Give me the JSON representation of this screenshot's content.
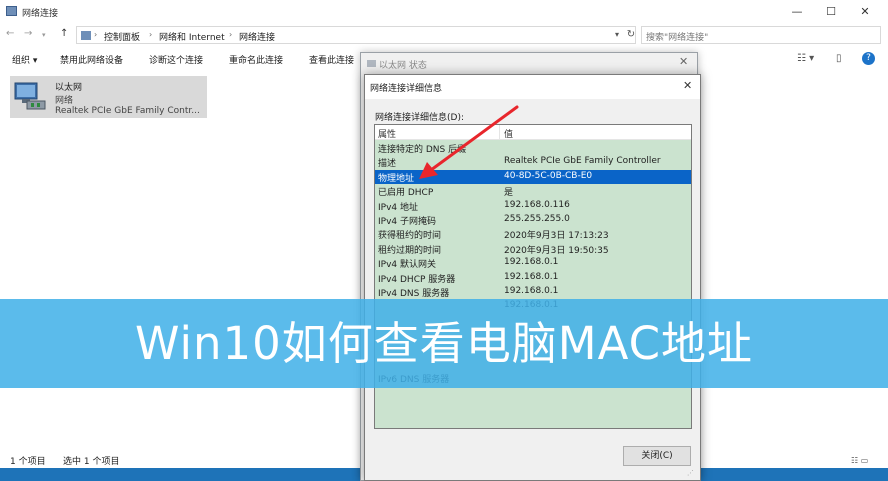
{
  "window": {
    "title": "网络连接",
    "minimize": "—",
    "maximize": "☐",
    "close": "✕"
  },
  "nav": {
    "back": "←",
    "forward": "→",
    "recent": "▾",
    "up": "↑",
    "breadcrumb": [
      "控制面板",
      "网络和 Internet",
      "网络连接"
    ],
    "separator": "›",
    "dropdown": "▾",
    "refresh": "↻",
    "search_placeholder": "搜索\"网络连接\""
  },
  "toolbar": {
    "items": [
      "组织 ▾",
      "禁用此网络设备",
      "诊断这个连接",
      "重命名此连接",
      "查看此连接"
    ],
    "view_icon": "☷ ▾",
    "pane_icon": "▯",
    "help": "?"
  },
  "adapter": {
    "name": "以太网",
    "network": "网络",
    "device": "Realtek PCIe GbE Family Contr..."
  },
  "statusbar": {
    "count": "1 个项目",
    "selected": "选中 1 个项目",
    "view_icons": "☷ ▭"
  },
  "status_dialog": {
    "title": "以太网 状态",
    "close": "✕"
  },
  "detail_dialog": {
    "title": "网络连接详细信息",
    "close": "✕",
    "label": "网络连接详细信息(D):",
    "columns": {
      "property": "属性",
      "value": "值"
    },
    "rows": [
      {
        "property": "连接特定的 DNS 后缀",
        "value": ""
      },
      {
        "property": "描述",
        "value": "Realtek PCIe GbE Family Controller"
      },
      {
        "property": "物理地址",
        "value": "40-8D-5C-0B-CB-E0",
        "selected": true
      },
      {
        "property": "已启用 DHCP",
        "value": "是"
      },
      {
        "property": "IPv4 地址",
        "value": "192.168.0.116"
      },
      {
        "property": "IPv4 子网掩码",
        "value": "255.255.255.0"
      },
      {
        "property": "获得租约的时间",
        "value": "2020年9月3日 17:13:23"
      },
      {
        "property": "租约过期的时间",
        "value": "2020年9月3日 19:50:35"
      },
      {
        "property": "IPv4 默认网关",
        "value": "192.168.0.1"
      },
      {
        "property": "IPv4 DHCP 服务器",
        "value": "192.168.0.1"
      },
      {
        "property": "IPv4 DNS 服务器",
        "value": "192.168.0.1"
      },
      {
        "property": "",
        "value": "192.168.0.1"
      }
    ],
    "partial_row": {
      "property": "IPv6 DNS 服务器",
      "value": ""
    },
    "close_button": "关闭(C)"
  },
  "banner": {
    "text": "Win10如何查看电脑MAC地址"
  },
  "colors": {
    "list_bg": "#cbe3cf",
    "selection": "#0a64c8",
    "banner": "#40b0e8",
    "arrow": "#e8262c"
  }
}
